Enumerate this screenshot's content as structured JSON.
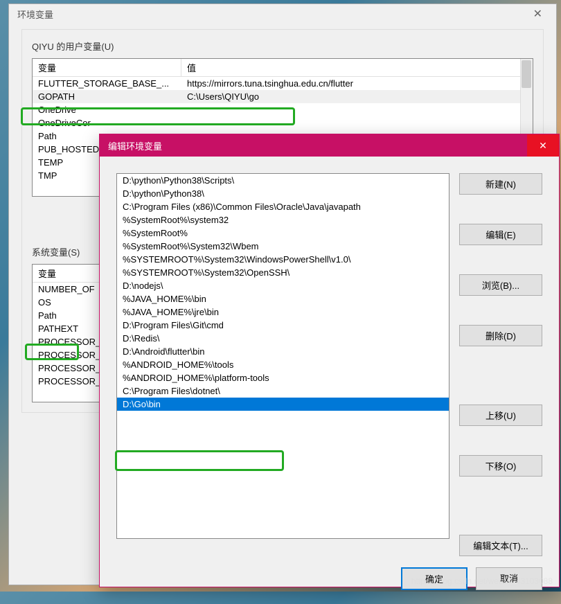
{
  "dialog1": {
    "title": "环境变量",
    "close": "✕",
    "user_section_label": "QIYU 的用户变量(U)",
    "system_section_label": "系统变量(S)",
    "col_var": "变量",
    "col_val": "值",
    "user_vars": [
      {
        "name": "FLUTTER_STORAGE_BASE_...",
        "value": "https://mirrors.tuna.tsinghua.edu.cn/flutter"
      },
      {
        "name": "GOPATH",
        "value": "C:\\Users\\QIYU\\go"
      },
      {
        "name": "OneDrive",
        "value": ""
      },
      {
        "name": "OneDriveCor",
        "value": ""
      },
      {
        "name": "Path",
        "value": ""
      },
      {
        "name": "PUB_HOSTED",
        "value": ""
      },
      {
        "name": "TEMP",
        "value": ""
      },
      {
        "name": "TMP",
        "value": ""
      }
    ],
    "system_vars": [
      {
        "name": "NUMBER_OF",
        "value": ""
      },
      {
        "name": "OS",
        "value": ""
      },
      {
        "name": "Path",
        "value": ""
      },
      {
        "name": "PATHEXT",
        "value": ""
      },
      {
        "name": "PROCESSOR_",
        "value": ""
      },
      {
        "name": "PROCESSOR_",
        "value": ""
      },
      {
        "name": "PROCESSOR_",
        "value": ""
      },
      {
        "name": "PROCESSOR_",
        "value": ""
      }
    ]
  },
  "dialog2": {
    "title": "编辑环境变量",
    "close": "✕",
    "buttons": {
      "new": "新建(N)",
      "edit": "编辑(E)",
      "browse": "浏览(B)...",
      "delete": "删除(D)",
      "moveup": "上移(U)",
      "movedown": "下移(O)",
      "edittext": "编辑文本(T)...",
      "ok": "确定",
      "cancel": "取消"
    },
    "paths": [
      "D:\\python\\Python38\\Scripts\\",
      "D:\\python\\Python38\\",
      "C:\\Program Files (x86)\\Common Files\\Oracle\\Java\\javapath",
      "%SystemRoot%\\system32",
      "%SystemRoot%",
      "%SystemRoot%\\System32\\Wbem",
      "%SYSTEMROOT%\\System32\\WindowsPowerShell\\v1.0\\",
      "%SYSTEMROOT%\\System32\\OpenSSH\\",
      "D:\\nodejs\\",
      "%JAVA_HOME%\\bin",
      "%JAVA_HOME%\\jre\\bin",
      "D:\\Program Files\\Git\\cmd",
      "D:\\Redis\\",
      "D:\\Android\\flutter\\bin",
      "%ANDROID_HOME%\\tools",
      "%ANDROID_HOME%\\platform-tools",
      "C:\\Program Files\\dotnet\\",
      "D:\\Go\\bin"
    ]
  },
  "watermark": "https://blog.csdn.net/weixin_43103088"
}
